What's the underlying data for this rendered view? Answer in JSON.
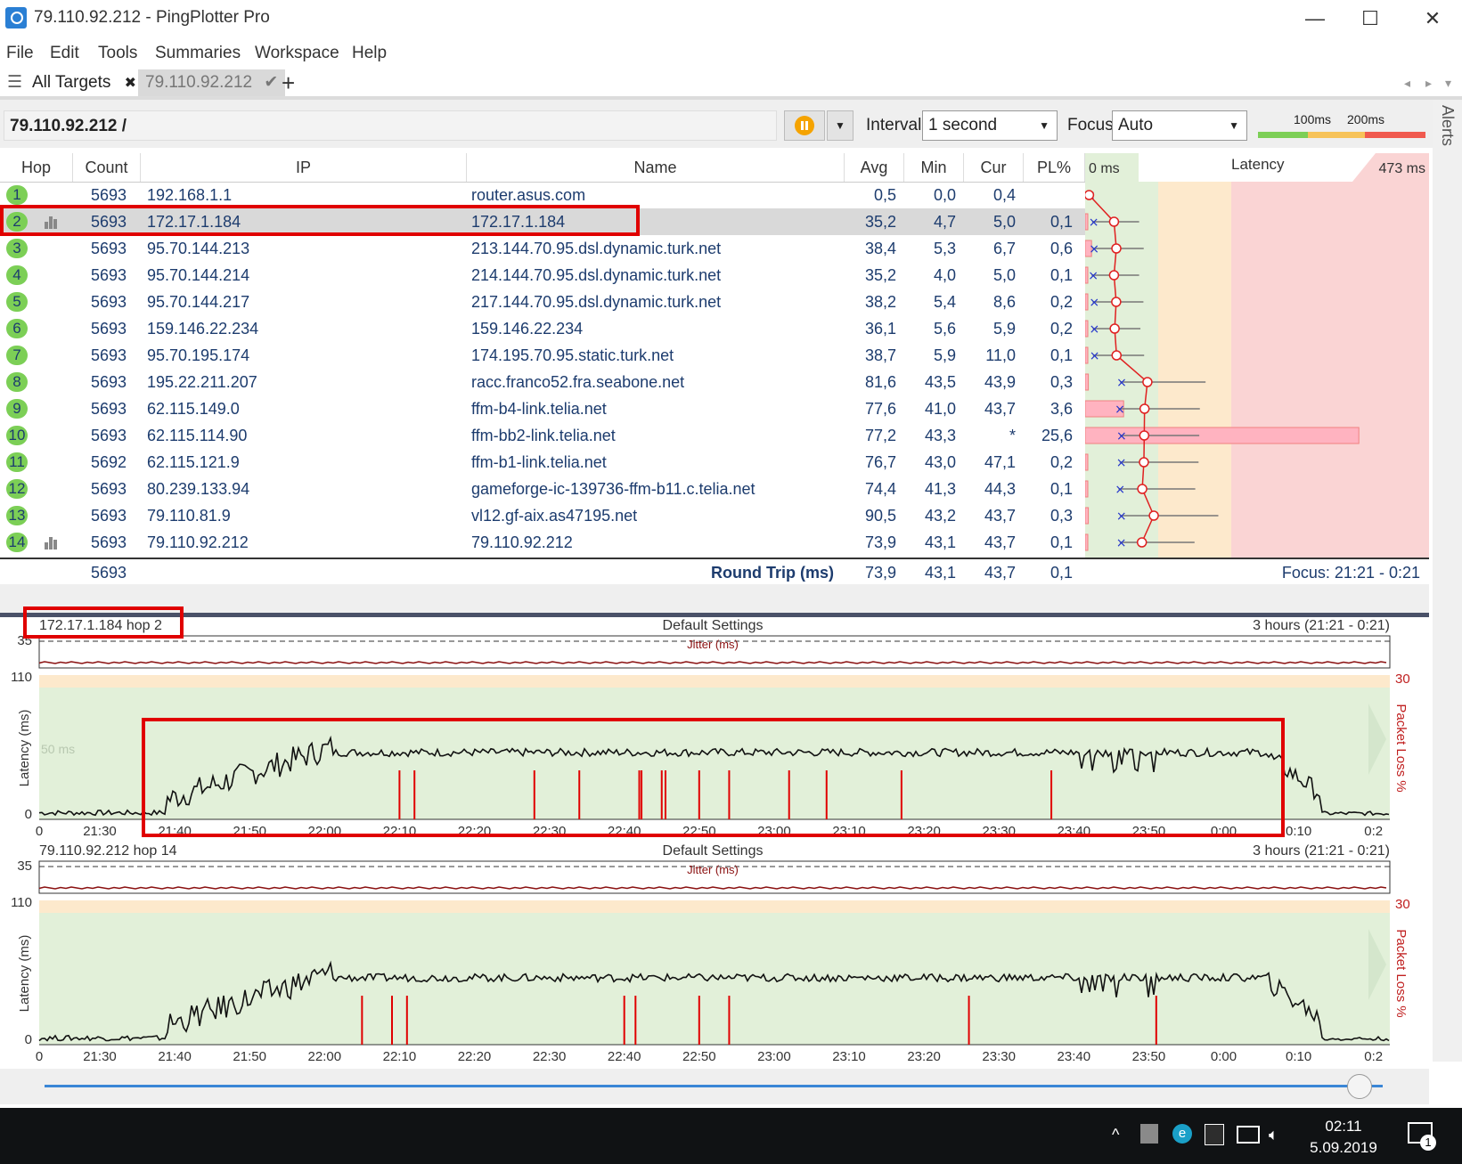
{
  "window": {
    "title": "79.110.92.212 - PingPlotter Pro"
  },
  "menu": [
    "File",
    "Edit",
    "Tools",
    "Summaries",
    "Workspace",
    "Help"
  ],
  "tabs": {
    "all_targets": "All Targets",
    "close": "✖",
    "target": "79.110.92.212",
    "check": "✔",
    "add": "+"
  },
  "toolbar": {
    "address": "79.110.92.212 /",
    "interval_label": "Interval",
    "interval_value": "1 second",
    "focus_label": "Focus",
    "focus_value": "Auto",
    "scale_100": "100ms",
    "scale_200": "200ms",
    "alerts": "Alerts"
  },
  "grid": {
    "headers": {
      "hop": "Hop",
      "count": "Count",
      "ip": "IP",
      "name": "Name",
      "avg": "Avg",
      "min": "Min",
      "cur": "Cur",
      "pl": "PL%"
    },
    "latency_header": {
      "min": "0 ms",
      "title": "Latency",
      "max": "473 ms"
    },
    "rows": [
      {
        "hop": "1",
        "count": "5693",
        "ip": "192.168.1.1",
        "name": "router.asus.com",
        "avg": "0,5",
        "min": "0,0",
        "cur": "0,4",
        "pl": "",
        "avg_ms": 0.5,
        "min_ms": 0.0,
        "pl_pct": 0,
        "bars": false
      },
      {
        "hop": "2",
        "count": "5693",
        "ip": "172.17.1.184",
        "name": "172.17.1.184",
        "avg": "35,2",
        "min": "4,7",
        "cur": "5,0",
        "pl": "0,1",
        "avg_ms": 35.2,
        "min_ms": 4.7,
        "pl_pct": 0.1,
        "bars": true
      },
      {
        "hop": "3",
        "count": "5693",
        "ip": "95.70.144.213",
        "name": "213.144.70.95.dsl.dynamic.turk.net",
        "avg": "38,4",
        "min": "5,3",
        "cur": "6,7",
        "pl": "0,6",
        "avg_ms": 38.4,
        "min_ms": 5.3,
        "pl_pct": 0.6,
        "bars": false
      },
      {
        "hop": "4",
        "count": "5693",
        "ip": "95.70.144.214",
        "name": "214.144.70.95.dsl.dynamic.turk.net",
        "avg": "35,2",
        "min": "4,0",
        "cur": "5,0",
        "pl": "0,1",
        "avg_ms": 35.2,
        "min_ms": 4.0,
        "pl_pct": 0.1,
        "bars": false
      },
      {
        "hop": "5",
        "count": "5693",
        "ip": "95.70.144.217",
        "name": "217.144.70.95.dsl.dynamic.turk.net",
        "avg": "38,2",
        "min": "5,4",
        "cur": "8,6",
        "pl": "0,2",
        "avg_ms": 38.2,
        "min_ms": 5.4,
        "pl_pct": 0.2,
        "bars": false
      },
      {
        "hop": "6",
        "count": "5693",
        "ip": "159.146.22.234",
        "name": "159.146.22.234",
        "avg": "36,1",
        "min": "5,6",
        "cur": "5,9",
        "pl": "0,2",
        "avg_ms": 36.1,
        "min_ms": 5.6,
        "pl_pct": 0.2,
        "bars": false
      },
      {
        "hop": "7",
        "count": "5693",
        "ip": "95.70.195.174",
        "name": "174.195.70.95.static.turk.net",
        "avg": "38,7",
        "min": "5,9",
        "cur": "11,0",
        "pl": "0,1",
        "avg_ms": 38.7,
        "min_ms": 5.9,
        "pl_pct": 0.1,
        "bars": false
      },
      {
        "hop": "8",
        "count": "5693",
        "ip": "195.22.211.207",
        "name": "racc.franco52.fra.seabone.net",
        "avg": "81,6",
        "min": "43,5",
        "cur": "43,9",
        "pl": "0,3",
        "avg_ms": 81.6,
        "min_ms": 43.5,
        "pl_pct": 0.3,
        "bars": false
      },
      {
        "hop": "9",
        "count": "5693",
        "ip": "62.115.149.0",
        "name": "ffm-b4-link.telia.net",
        "avg": "77,6",
        "min": "41,0",
        "cur": "43,7",
        "pl": "3,6",
        "avg_ms": 77.6,
        "min_ms": 41.0,
        "pl_pct": 3.6,
        "bars": false
      },
      {
        "hop": "10",
        "count": "5693",
        "ip": "62.115.114.90",
        "name": "ffm-bb2-link.telia.net",
        "avg": "77,2",
        "min": "43,3",
        "cur": "*",
        "pl": "25,6",
        "avg_ms": 77.2,
        "min_ms": 43.3,
        "pl_pct": 25.6,
        "bars": false
      },
      {
        "hop": "11",
        "count": "5692",
        "ip": "62.115.121.9",
        "name": "ffm-b1-link.telia.net",
        "avg": "76,7",
        "min": "43,0",
        "cur": "47,1",
        "pl": "0,2",
        "avg_ms": 76.7,
        "min_ms": 43.0,
        "pl_pct": 0.2,
        "bars": false
      },
      {
        "hop": "12",
        "count": "5693",
        "ip": "80.239.133.94",
        "name": "gameforge-ic-139736-ffm-b11.c.telia.net",
        "avg": "74,4",
        "min": "41,3",
        "cur": "44,3",
        "pl": "0,1",
        "avg_ms": 74.4,
        "min_ms": 41.3,
        "pl_pct": 0.1,
        "bars": false
      },
      {
        "hop": "13",
        "count": "5693",
        "ip": "79.110.81.9",
        "name": "vl12.gf-aix.as47195.net",
        "avg": "90,5",
        "min": "43,2",
        "cur": "43,7",
        "pl": "0,3",
        "avg_ms": 90.5,
        "min_ms": 43.2,
        "pl_pct": 0.3,
        "bars": false
      },
      {
        "hop": "14",
        "count": "5693",
        "ip": "79.110.92.212",
        "name": "79.110.92.212",
        "avg": "73,9",
        "min": "43,1",
        "cur": "43,7",
        "pl": "0,1",
        "avg_ms": 73.9,
        "min_ms": 43.1,
        "pl_pct": 0.1,
        "bars": true
      }
    ],
    "footer": {
      "count": "5693",
      "label": "Round Trip (ms)",
      "avg": "73,9",
      "min": "43,1",
      "cur": "43,7",
      "pl": "0,1",
      "focus": "Focus: 21:21 - 0:21"
    }
  },
  "charts": [
    {
      "target": "172.17.1.184 hop 2",
      "settings": "Default Settings",
      "range": "3 hours (21:21 - 0:21)",
      "jitter_label": "Jitter (ms)",
      "jitter_max": "35",
      "lat_max": "110",
      "lat_zero": "0",
      "lat_50": "50 ms",
      "pl_max": "30",
      "ylabel": "Latency (ms)",
      "y2label": "Packet Loss %",
      "x_ticks": [
        "0",
        "21:30",
        "21:40",
        "21:50",
        "22:00",
        "22:10",
        "22:20",
        "22:30",
        "22:40",
        "22:50",
        "23:00",
        "23:10",
        "23:20",
        "23:30",
        "23:40",
        "23:50",
        "0:00",
        "0:10",
        "0:2"
      ],
      "loss_times_min": [
        49,
        51,
        67,
        73,
        81,
        81.3,
        84,
        84.5,
        89,
        93,
        101,
        106,
        116,
        136
      ]
    },
    {
      "target": "79.110.92.212 hop 14",
      "settings": "Default Settings",
      "range": "3 hours (21:21 - 0:21)",
      "jitter_label": "Jitter (ms)",
      "jitter_max": "35",
      "lat_max": "110",
      "lat_zero": "0",
      "lat_50": "",
      "pl_max": "30",
      "ylabel": "Latency (ms)",
      "y2label": "Packet Loss %",
      "x_ticks": [
        "0",
        "21:30",
        "21:40",
        "21:50",
        "22:00",
        "22:10",
        "22:20",
        "22:30",
        "22:40",
        "22:50",
        "23:00",
        "23:10",
        "23:20",
        "23:30",
        "23:40",
        "23:50",
        "0:00",
        "0:10",
        "0:2"
      ],
      "loss_times_min": [
        44,
        48,
        50,
        79,
        80.5,
        89,
        93,
        125,
        150
      ]
    }
  ],
  "taskbar": {
    "time": "02:11",
    "date": "5.09.2019",
    "notifications": "1"
  },
  "colors": {
    "accent_green": "#7ccf56",
    "pl_red": "#e00000",
    "latency_red": "#ff3b30",
    "chart_bg": "#e2f0d9"
  }
}
